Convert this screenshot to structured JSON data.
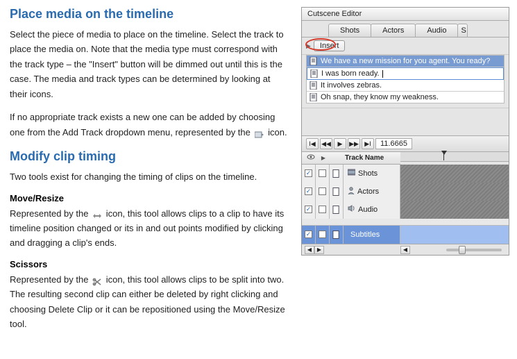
{
  "doc": {
    "h1": "Place media on the timeline",
    "p1": "Select the piece of media to place on the timeline. Select the track to place the media on. Note that the media type must correspond with the track type – the \"Insert\" button will be dimmed out until this is the case. The media and track types can be determined by looking at their icons.",
    "p2_a": "If no appropriate track exists a new one can be added by choosing one from the Add Track dropdown menu, represented by the ",
    "p2_b": " icon.",
    "h2": "Modify clip timing",
    "p3": "Two tools exist for changing the timing of clips on the timeline.",
    "sub1": "Move/Resize",
    "p4_a": "Represented by the ",
    "p4_b": " icon, this tool allows clips to a clip to have its timeline position changed or its in and out points modified by clicking and dragging a clip's ends.",
    "sub2": "Scissors",
    "p5_a": "Represented by the ",
    "p5_b": " icon, this tool allows clips to be split into two. The resulting second clip can either be deleted by right clicking and choosing Delete Clip or it can be repositioned using the Move/Resize tool."
  },
  "editor": {
    "title": "Cutscene Editor",
    "tabs": [
      "Shots",
      "Actors",
      "Audio",
      "S"
    ],
    "insert_label": "Insert",
    "dialogue": [
      "We have a new mission for you agent. You ready?",
      "I was born ready.",
      "It involves zebras.",
      "Oh snap, they know my weakness."
    ],
    "time_value": "11.6665",
    "track_header": "Track Name",
    "tracks": [
      {
        "name": "Shots",
        "icon": "shots",
        "selected": false
      },
      {
        "name": "Actors",
        "icon": "actors",
        "selected": false
      },
      {
        "name": "Audio",
        "icon": "audio",
        "selected": false
      },
      {
        "name": "Subtitles",
        "icon": "subtitles",
        "selected": true
      }
    ]
  }
}
